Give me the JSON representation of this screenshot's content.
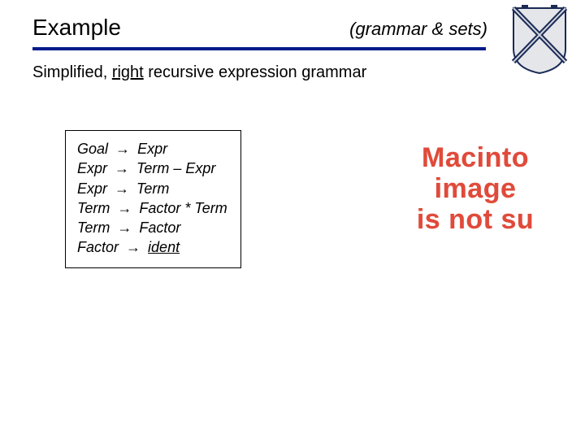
{
  "header": {
    "title": "Example",
    "right": "(grammar & sets)"
  },
  "body": {
    "line_pre": "Simplified, ",
    "line_u": "right",
    "line_post": " recursive expression grammar"
  },
  "grammar": {
    "arrow": "→",
    "rules": [
      {
        "lhs": "Goal",
        "rhs": "Expr"
      },
      {
        "lhs": "Expr",
        "rhs": "Term – Expr"
      },
      {
        "lhs": "Expr",
        "rhs": "Term"
      },
      {
        "lhs": "Term",
        "rhs": "Factor * Term"
      },
      {
        "lhs": "Term",
        "rhs": "Factor"
      },
      {
        "lhs": "Factor",
        "rhs_ident": "ident"
      }
    ]
  },
  "missing": {
    "l1": "Macinto",
    "l2": "image",
    "l3": "is not su"
  }
}
